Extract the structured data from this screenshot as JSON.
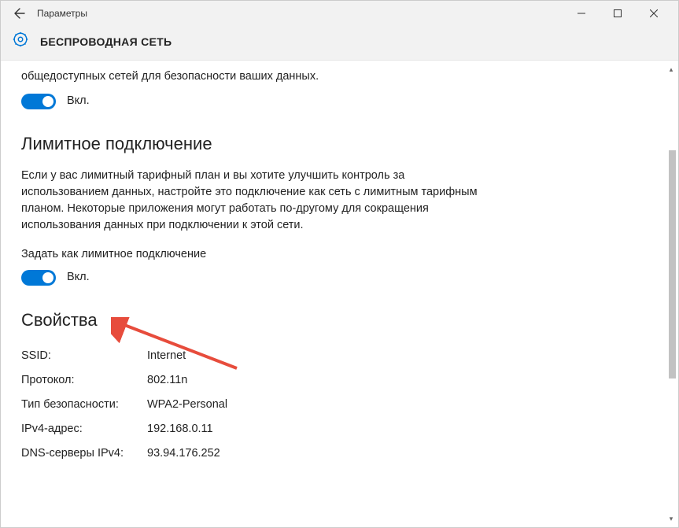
{
  "titlebar": {
    "title": "Параметры"
  },
  "subheader": {
    "title": "БЕСПРОВОДНАЯ СЕТЬ"
  },
  "truncated": {
    "text": "общедоступных сетей для безопасности ваших данных.",
    "toggle_label": "Вкл."
  },
  "metered": {
    "heading": "Лимитное подключение",
    "description": "Если у вас лимитный тарифный план и вы хотите улучшить контроль за использованием данных, настройте это подключение как сеть с лимитным тарифным планом. Некоторые приложения могут работать по-другому для сокращения использования данных при подключении к этой сети.",
    "set_label": "Задать как лимитное подключение",
    "toggle_label": "Вкл."
  },
  "properties": {
    "heading": "Свойства",
    "rows": [
      {
        "key": "SSID:",
        "val": "Internet"
      },
      {
        "key": "Протокол:",
        "val": "802.11n"
      },
      {
        "key": "Тип безопасности:",
        "val": "WPA2-Personal"
      },
      {
        "key": "IPv4-адрес:",
        "val": "192.168.0.11"
      },
      {
        "key": "DNS-серверы IPv4:",
        "val": "93.94.176.252"
      }
    ]
  }
}
